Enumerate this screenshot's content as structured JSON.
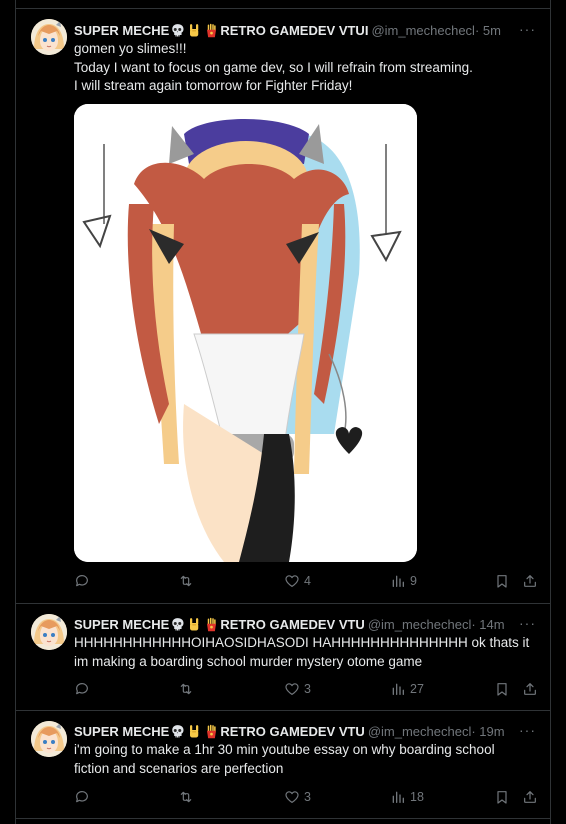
{
  "colors": {
    "background": "#000000",
    "text": "#e7e9ea",
    "muted": "#71767b",
    "border": "#2f3336"
  },
  "tweets": [
    {
      "display_name_1": "SUPER MECHE",
      "emojis": [
        "skull-emoji",
        "sign-of-horns-emoji",
        "fries-emoji"
      ],
      "display_name_2": "RETRO GAMEDEV VTUI",
      "handle": "@im_mechechecl",
      "time": "· 5m",
      "lines": [
        "gomen yo slimes!!!",
        "Today I want to focus on game dev, so I will refrain from streaming.",
        "I will stream again tomorrow for Fighter Friday!"
      ],
      "has_media": true,
      "media_alt": "drawing of a character bowing with long red and blonde hair",
      "replies": "",
      "reposts": "",
      "likes": "4",
      "views": "9"
    },
    {
      "display_name_1": "SUPER MECHE",
      "emojis": [
        "skull-emoji",
        "sign-of-horns-emoji",
        "fries-emoji"
      ],
      "display_name_2": "RETRO GAMEDEV VTU",
      "handle": "@im_mechechecl",
      "time": "· 14m",
      "lines": [
        "HHHHHHHHHHHHOIHAOSIDHASODI HAHHHHHHHHHHHHHH ok thats it",
        "im making a boarding school murder mystery otome game"
      ],
      "has_media": false,
      "replies": "",
      "reposts": "",
      "likes": "3",
      "views": "27"
    },
    {
      "display_name_1": "SUPER MECHE",
      "emojis": [
        "skull-emoji",
        "sign-of-horns-emoji",
        "fries-emoji"
      ],
      "display_name_2": "RETRO GAMEDEV VTU",
      "handle": "@im_mechechecl",
      "time": "· 19m",
      "lines": [
        "i'm going to make a 1hr 30 min youtube essay on why boarding school",
        "fiction and scenarios are perfection"
      ],
      "has_media": false,
      "replies": "",
      "reposts": "",
      "likes": "3",
      "views": "18"
    }
  ]
}
